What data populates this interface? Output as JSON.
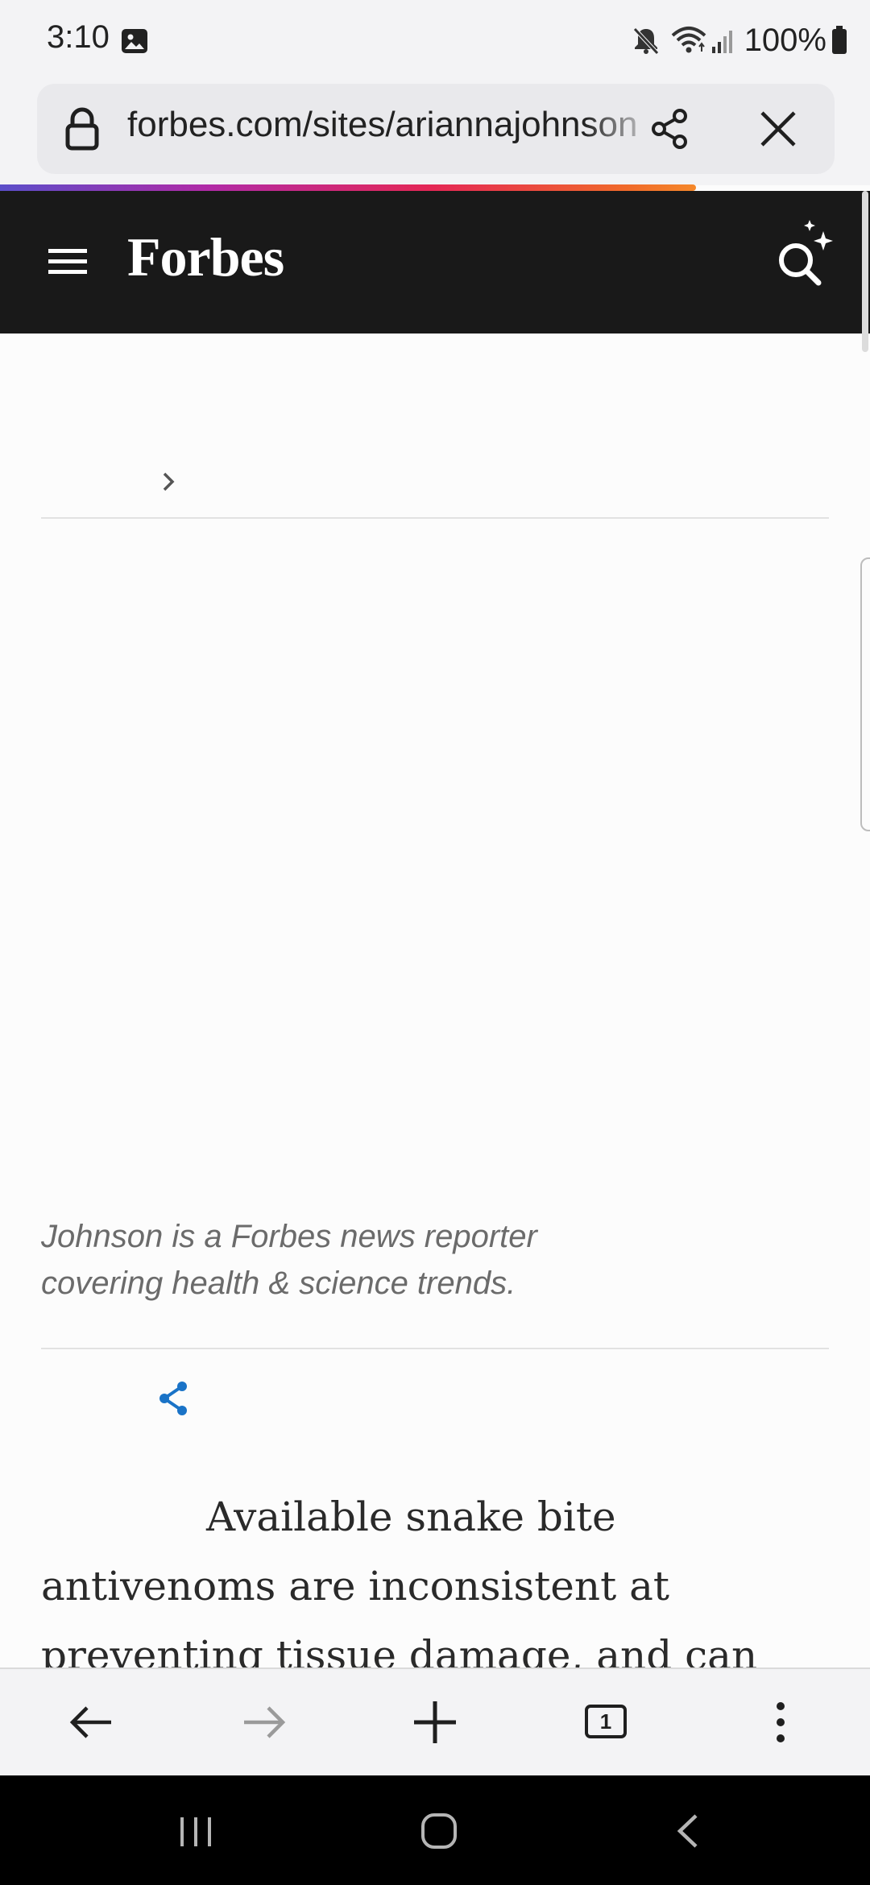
{
  "status_bar": {
    "time": "3:10",
    "battery": "100%",
    "icons": [
      "gallery-icon",
      "mute-icon",
      "wifi-icon",
      "signal-icon",
      "battery-icon"
    ]
  },
  "browser": {
    "url": "forbes.com/sites/ariannajohnson",
    "progress_fraction": 0.8,
    "tab_count": "1"
  },
  "site": {
    "logo": "Forbes",
    "icons": [
      "menu-icon",
      "ai-search-icon"
    ]
  },
  "article": {
    "author_bio": "Johnson is a Forbes news reporter covering health & science trends.",
    "body_text": "Available snake bite antivenoms are inconsistent at preventing tissue damage, and can"
  },
  "colors": {
    "header_bg": "#191919",
    "share_accent": "#1a73c7",
    "progress_gradient": [
      "#5b4ec9",
      "#b12aa6",
      "#e42755",
      "#f5882a"
    ]
  }
}
